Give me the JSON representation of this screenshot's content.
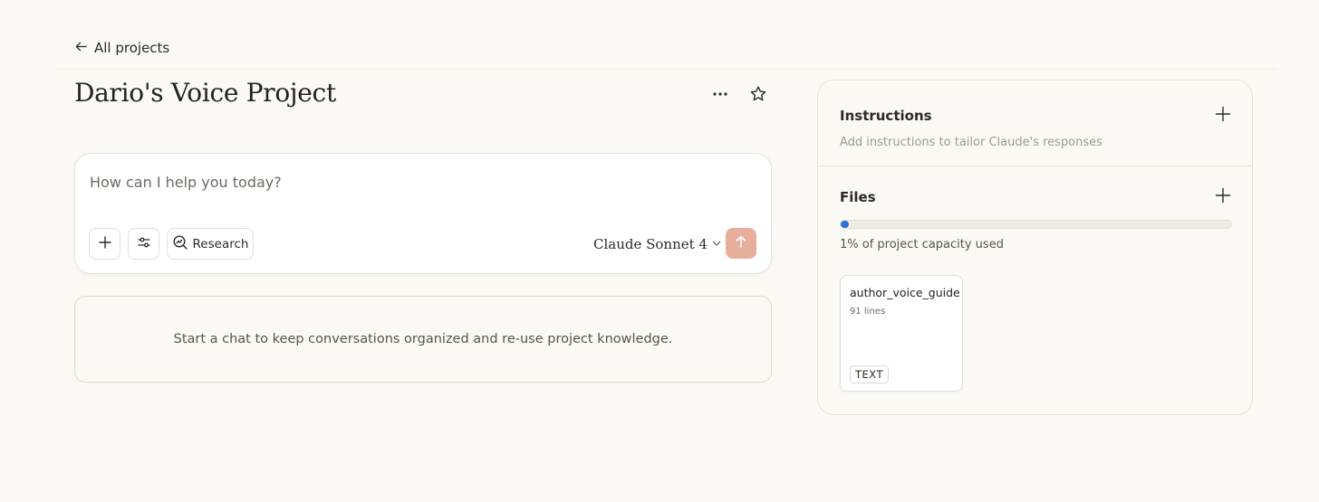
{
  "nav": {
    "back_label": "All projects"
  },
  "project": {
    "title": "Dario's Voice Project"
  },
  "composer": {
    "placeholder": "How can I help you today?",
    "value": "",
    "research_label": "Research",
    "model_label": "Claude Sonnet 4"
  },
  "empty_state": {
    "text": "Start a chat to keep conversations organized and re-use project knowledge."
  },
  "panel": {
    "instructions": {
      "title": "Instructions",
      "hint": "Add instructions to tailor Claude's responses"
    },
    "files": {
      "title": "Files",
      "capacity_percent": 1,
      "capacity_text": "1% of project capacity used",
      "items": [
        {
          "name": "author_voice_guide.x",
          "lines": "91 lines",
          "type": "TEXT"
        }
      ]
    }
  },
  "colors": {
    "background": "#faf9f5",
    "send_button": "#e6ae9b",
    "capacity_fill": "#2f6fd6"
  },
  "icons": {
    "back": "arrow-left-icon",
    "more": "ellipsis-icon",
    "star": "star-icon",
    "add": "plus-icon",
    "settings": "sliders-icon",
    "research": "search-icon",
    "model_dropdown": "chevron-down-icon",
    "send": "arrow-up-icon"
  }
}
